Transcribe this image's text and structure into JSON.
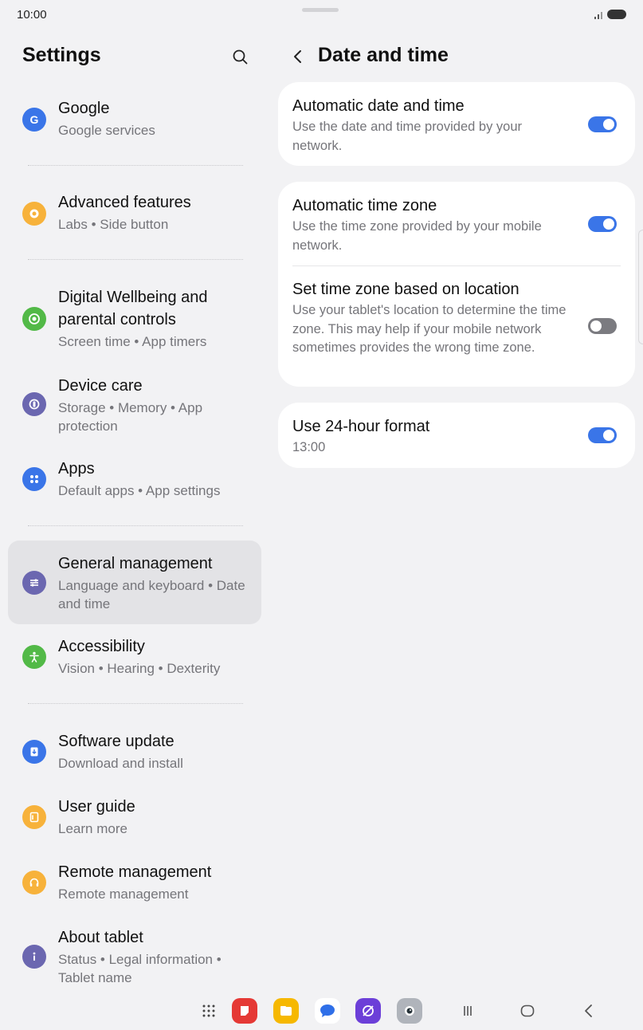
{
  "status_bar": {
    "time": "10:00"
  },
  "left_pane": {
    "title": "Settings",
    "items": [
      {
        "title": "Google",
        "subtitle": "Google services",
        "icon": "google-icon",
        "color": "#3a75e8"
      },
      {
        "title": "Advanced features",
        "subtitle": "Labs  •  Side button",
        "icon": "gear-plus-icon",
        "color": "#f7b23b"
      },
      {
        "title": "Digital Wellbeing and parental controls",
        "subtitle": "Screen time  •  App timers",
        "icon": "wellbeing-heart-icon",
        "color": "#52b947"
      },
      {
        "title": "Device care",
        "subtitle": "Storage  •  Memory  •  App protection",
        "icon": "device-care-icon",
        "color": "#6b67b0"
      },
      {
        "title": "Apps",
        "subtitle": "Default apps  •  App settings",
        "icon": "apps-grid-icon",
        "color": "#3a75e8"
      },
      {
        "title": "General management",
        "subtitle": "Language and keyboard  •  Date and time",
        "icon": "sliders-icon",
        "color": "#6b67b0"
      },
      {
        "title": "Accessibility",
        "subtitle": "Vision  •  Hearing  •  Dexterity",
        "icon": "accessibility-person-icon",
        "color": "#52b947"
      },
      {
        "title": "Software update",
        "subtitle": "Download and install",
        "icon": "download-icon",
        "color": "#3a75e8"
      },
      {
        "title": "User guide",
        "subtitle": "Learn more",
        "icon": "book-icon",
        "color": "#f7b23b"
      },
      {
        "title": "Remote management",
        "subtitle": "Remote management",
        "icon": "headset-icon",
        "color": "#f7b23b"
      },
      {
        "title": "About tablet",
        "subtitle": "Status  •  Legal information  •  Tablet name",
        "icon": "info-icon",
        "color": "#6b67b0"
      }
    ]
  },
  "right_pane": {
    "title": "Date and time",
    "auto_date": {
      "title": "Automatic date and time",
      "subtitle": "Use the date and time provided by your network.",
      "enabled": true
    },
    "auto_zone": {
      "title": "Automatic time zone",
      "subtitle": "Use the time zone provided by your mobile network.",
      "enabled": true
    },
    "location_zone": {
      "title": "Set time zone based on location",
      "subtitle": "Use your tablet's location to determine the time zone. This may help if your mobile network sometimes provides the wrong time zone.",
      "enabled": false
    },
    "hour_format": {
      "title": "Use 24-hour format",
      "subtitle": "13:00",
      "enabled": true
    }
  },
  "navbar": {
    "apps": [
      "app-drawer-icon",
      "notes-app-icon",
      "files-app-icon",
      "messages-app-icon",
      "internet-app-icon",
      "camera-app-icon"
    ],
    "buttons": [
      "recents-icon",
      "home-icon",
      "back-icon"
    ]
  },
  "colors": {
    "accent": "#3a75e8",
    "background": "#f2f2f4",
    "card": "#ffffff",
    "selected": "#e3e3e6"
  }
}
